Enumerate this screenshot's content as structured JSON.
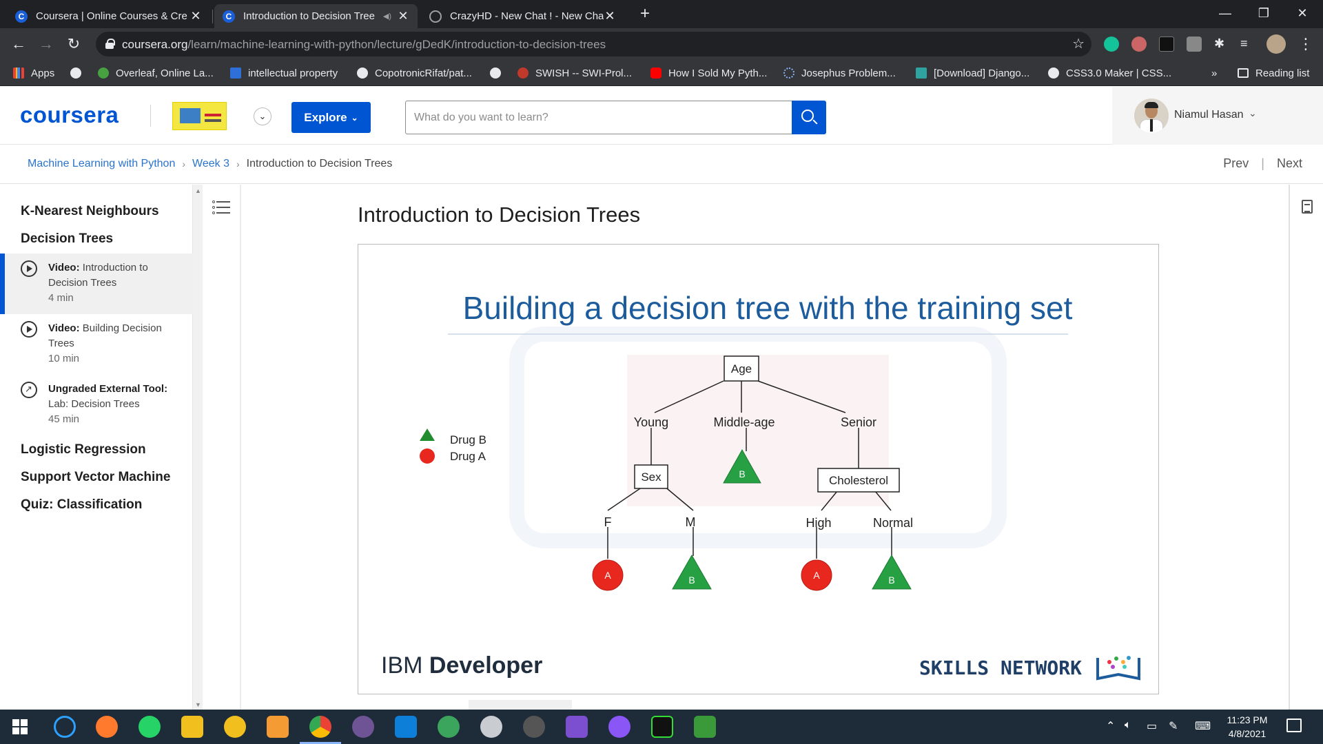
{
  "browser": {
    "tabs": [
      {
        "title": "Coursera | Online Courses & Cre",
        "favicon": "coursera-icon"
      },
      {
        "title": "Introduction to Decision Tree",
        "favicon": "coursera-icon",
        "active": true,
        "muted_icon": "speaker-icon"
      },
      {
        "title": "CrazyHD - New Chat ! - New Cha",
        "favicon": "globe-icon"
      }
    ],
    "new_tab": "+",
    "url_host": "coursera.org",
    "url_path": "/learn/machine-learning-with-python/lecture/gDedK/introduction-to-decision-trees",
    "bookmarks": [
      {
        "label": "Apps",
        "icon": "apps-grid-icon"
      },
      {
        "label": "",
        "icon": "globe-icon"
      },
      {
        "label": "Overleaf, Online La...",
        "icon": "overleaf-icon"
      },
      {
        "label": "intellectual property",
        "icon": "s-icon"
      },
      {
        "label": "CopotronicRifat/pat...",
        "icon": "github-icon"
      },
      {
        "label": "",
        "icon": "globe-icon"
      },
      {
        "label": "SWISH -- SWI-Prol...",
        "icon": "swish-icon"
      },
      {
        "label": "How I Sold My Pyth...",
        "icon": "youtube-icon"
      },
      {
        "label": "Josephus Problem...",
        "icon": "loading-icon"
      },
      {
        "label": "[Download] Django...",
        "icon": "django-icon"
      },
      {
        "label": "CSS3.0 Maker | CSS...",
        "icon": "globe-icon"
      }
    ],
    "more_bookmarks": "»",
    "reading_list": "Reading list"
  },
  "header": {
    "logo": "coursera",
    "explore_label": "Explore",
    "search_placeholder": "What do you want to learn?",
    "username": "Niamul Hasan"
  },
  "breadcrumb": {
    "course": "Machine Learning with Python",
    "week": "Week 3",
    "lesson": "Introduction to Decision Trees",
    "prev": "Prev",
    "next": "Next"
  },
  "sidebar": {
    "modules_top": [
      "K-Nearest Neighbours",
      "Decision Trees"
    ],
    "items": [
      {
        "type": "Video:",
        "title": "Introduction to Decision Trees",
        "duration": "4 min",
        "active": true
      },
      {
        "type": "Video:",
        "title": "Building Decision Trees",
        "duration": "10 min"
      },
      {
        "type": "Ungraded External Tool:",
        "title": "Lab: Decision Trees",
        "duration": "45 min"
      }
    ],
    "modules_bottom": [
      "Logistic Regression",
      "Support Vector Machine",
      "Quiz: Classification"
    ]
  },
  "content": {
    "title": "Introduction to Decision Trees",
    "slide": {
      "heading": "Building a decision tree with the training set",
      "legend": [
        {
          "label": "Drug B",
          "shape": "triangle",
          "color": "#1e8c2f"
        },
        {
          "label": "Drug A",
          "shape": "circle",
          "color": "#e8281e"
        }
      ],
      "tree": {
        "root": "Age",
        "branches": [
          "Young",
          "Middle-age",
          "Senior"
        ],
        "sex_node": "Sex",
        "sex_branches": [
          "F",
          "M"
        ],
        "chol_node": "Cholesterol",
        "chol_branches": [
          "High",
          "Normal"
        ],
        "leaf_a": "A",
        "leaf_b": "B"
      },
      "footer_left_light": "IBM ",
      "footer_left_bold": "Developer",
      "footer_right": "SKILLS NETWORK"
    }
  },
  "taskbar": {
    "time": "11:23 PM",
    "date": "4/8/2021"
  },
  "colors": {
    "brand": "#0056d2",
    "slide_heading": "#1d5c9c",
    "drug_a": "#e8281e",
    "drug_b": "#1e8c2f"
  }
}
